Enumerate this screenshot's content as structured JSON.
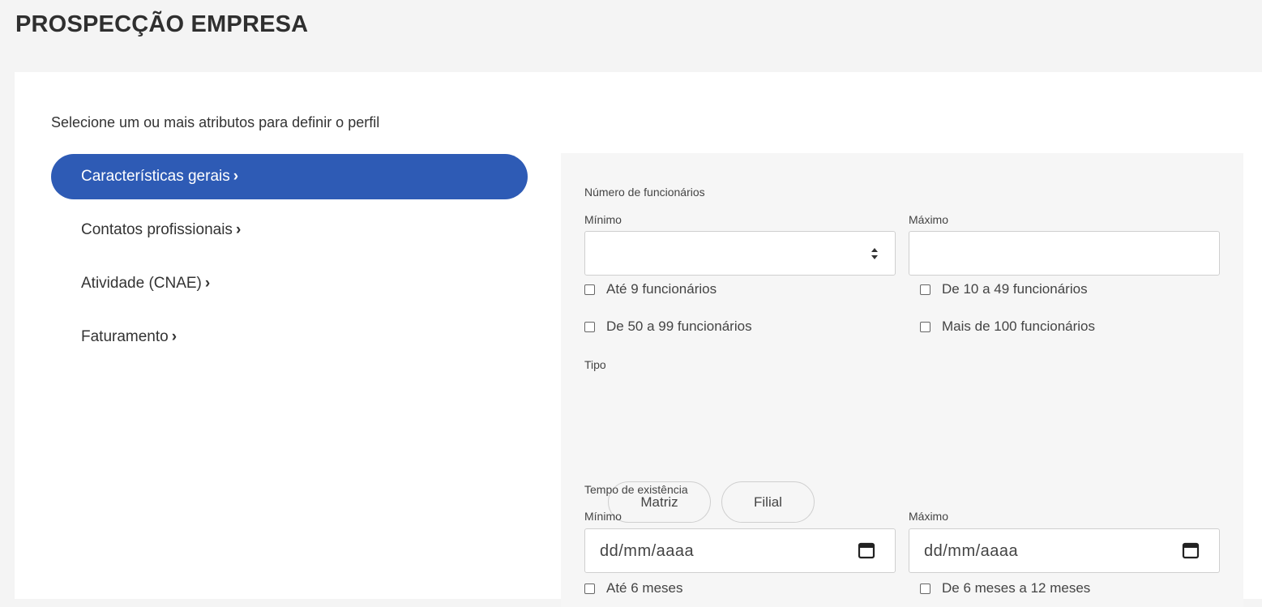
{
  "page": {
    "title": "PROSPECÇÃO EMPRESA"
  },
  "intro": "Selecione um ou mais atributos para definir o perfil",
  "nav": {
    "items": [
      {
        "label": "Características gerais",
        "active": true
      },
      {
        "label": "Contatos profissionais",
        "active": false
      },
      {
        "label": "Atividade (CNAE)",
        "active": false
      },
      {
        "label": "Faturamento",
        "active": false
      }
    ],
    "chevron": "›"
  },
  "employees": {
    "section_label": "Número de funcionários",
    "min_label": "Mínimo",
    "max_label": "Máximo",
    "min_value": "",
    "max_value": "",
    "options": [
      {
        "label": "Até 9 funcionários",
        "checked": false
      },
      {
        "label": "De 10 a 49 funcionários",
        "checked": false
      },
      {
        "label": "De 50 a 99 funcionários",
        "checked": false
      },
      {
        "label": "Mais de 100 funcionários",
        "checked": false
      }
    ]
  },
  "type": {
    "section_label": "Tipo",
    "buttons": [
      {
        "label": "Matriz"
      },
      {
        "label": "Filial"
      }
    ]
  },
  "existence": {
    "section_label": "Tempo de existência",
    "min_label": "Mínimo",
    "max_label": "Máximo",
    "min_placeholder": "dd/mm/aaaa",
    "max_placeholder": "dd/mm/aaaa",
    "options": [
      {
        "label": "Até 6 meses",
        "checked": false
      },
      {
        "label": "De 6 meses a 12 meses",
        "checked": false
      }
    ]
  },
  "colors": {
    "accent": "#2e5bb5",
    "panel_bg": "#f6f6f6",
    "page_bg": "#f4f4f4"
  }
}
